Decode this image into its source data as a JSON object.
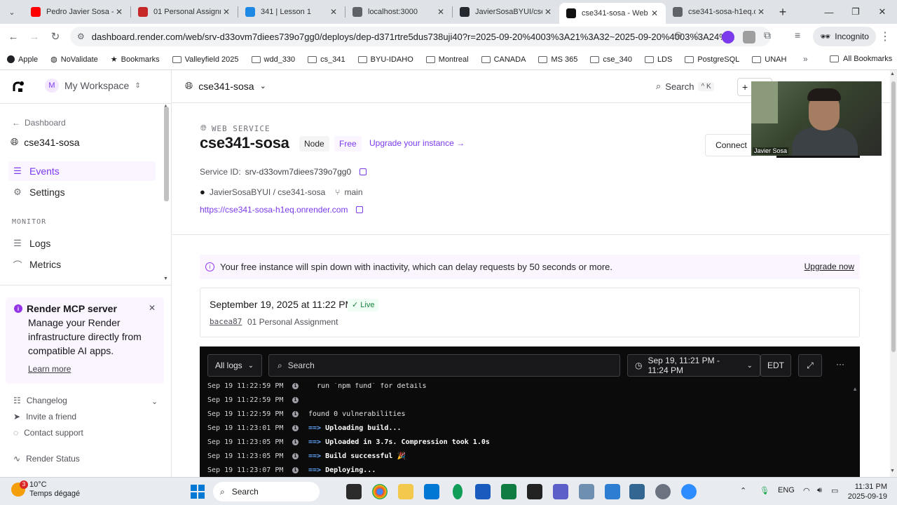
{
  "browser": {
    "tabs": [
      {
        "title": "Pedro Javier Sosa - Y",
        "favicon_color": "#ff0000"
      },
      {
        "title": "01 Personal Assignm",
        "favicon_color": "#c62828"
      },
      {
        "title": "341 | Lesson 1",
        "favicon_color": "#1e88e5"
      },
      {
        "title": "localhost:3000",
        "favicon_color": "#5f6368"
      },
      {
        "title": "JavierSosaBYUI/cse3",
        "favicon_color": "#24292f"
      },
      {
        "title": "cse341-sosa - Web S",
        "favicon_color": "#111111",
        "active": true
      },
      {
        "title": "cse341-sosa-h1eq.or",
        "favicon_color": "#5f6368"
      }
    ],
    "url": "dashboard.render.com/web/srv-d33ovm7diees739o7gg0/deploys/dep-d371rtre5dus738uji40?r=2025-09-20%4003%3A21%3A32~2025-09-20%4003%3A24%...",
    "incognito_label": "Incognito",
    "bookmarks": [
      {
        "label": "Apple",
        "icon": "apple-icon"
      },
      {
        "label": "NoValidate",
        "icon": "globe-icon"
      },
      {
        "label": "Bookmarks",
        "icon": "star-icon"
      },
      {
        "label": "Valleyfield 2025",
        "icon": "folder-icon"
      },
      {
        "label": "wdd_330",
        "icon": "folder-icon"
      },
      {
        "label": "cs_341",
        "icon": "folder-icon"
      },
      {
        "label": "BYU-IDAHO",
        "icon": "folder-icon"
      },
      {
        "label": "Montreal",
        "icon": "folder-icon"
      },
      {
        "label": "CANADA",
        "icon": "folder-icon"
      },
      {
        "label": "MS 365",
        "icon": "folder-icon"
      },
      {
        "label": "cse_340",
        "icon": "folder-icon"
      },
      {
        "label": "LDS",
        "icon": "folder-icon"
      },
      {
        "label": "PostgreSQL",
        "icon": "folder-icon"
      },
      {
        "label": "UNAH",
        "icon": "folder-icon"
      }
    ],
    "all_bookmarks": "All Bookmarks"
  },
  "sidebar": {
    "workspace_initial": "M",
    "workspace": "My Workspace",
    "back_label": "Dashboard",
    "service_name": "cse341-sosa",
    "nav": [
      {
        "label": "Events",
        "icon": "list-icon",
        "active": true
      },
      {
        "label": "Settings",
        "icon": "gear-icon"
      }
    ],
    "monitor_label": "MONITOR",
    "monitor": [
      {
        "label": "Logs",
        "icon": "logs-icon"
      },
      {
        "label": "Metrics",
        "icon": "chart-icon"
      }
    ],
    "mcp": {
      "title": "Render MCP server",
      "body": "Manage your Render infrastructure directly from compatible AI apps.",
      "link": "Learn more"
    },
    "footer": [
      {
        "label": "Changelog",
        "icon": "changelog-icon"
      },
      {
        "label": "Invite a friend",
        "icon": "send-icon"
      },
      {
        "label": "Contact support",
        "icon": "chat-icon"
      },
      {
        "label": "Render Status",
        "icon": "pulse-icon"
      }
    ]
  },
  "topbar": {
    "project": "cse341-sosa",
    "search": "Search",
    "shortcut": "^ K",
    "plus": "+"
  },
  "service": {
    "kind": "WEB SERVICE",
    "name": "cse341-sosa",
    "runtime": "Node",
    "plan": "Free",
    "upgrade": "Upgrade your instance →",
    "connect": "Connect",
    "id_label": "Service ID:",
    "id": "srv-d33ovm7diees739o7gg0",
    "repo": "JavierSosaBYUI / cse341-sosa",
    "branch": "main",
    "url": "https://cse341-sosa-h1eq.onrender.com"
  },
  "banner": {
    "text": "Your free instance will spin down with inactivity, which can delay requests by 50 seconds or more.",
    "action": "Upgrade now"
  },
  "deploy": {
    "date": "September 19, 2025 at 11:22 PM",
    "status": "Live",
    "commit": "bacea87",
    "message": "01 Personal Assignment"
  },
  "logs": {
    "filter": "All logs",
    "search_placeholder": "Search",
    "range": "Sep 19, 11:21 PM - 11:24 PM",
    "timezone": "EDT",
    "lines": [
      {
        "ts": "Sep 19 11:22:59 PM",
        "msg": "  run `npm fund` for details",
        "style": "plain"
      },
      {
        "ts": "Sep 19 11:22:59 PM",
        "msg": "",
        "style": "plain"
      },
      {
        "ts": "Sep 19 11:22:59 PM",
        "msg": "found 0 vulnerabilities",
        "style": "plain"
      },
      {
        "ts": "Sep 19 11:23:01 PM",
        "msg": "Uploading build...",
        "style": "arrow"
      },
      {
        "ts": "Sep 19 11:23:05 PM",
        "msg": "Uploaded in 3.7s. Compression took 1.0s",
        "style": "arrow"
      },
      {
        "ts": "Sep 19 11:23:05 PM",
        "msg": "Build successful 🎉",
        "style": "arrow"
      },
      {
        "ts": "Sep 19 11:23:07 PM",
        "msg": "Deploying...",
        "style": "arrow"
      }
    ],
    "arrow": "==>"
  },
  "webcam": {
    "name": "Javier Sosa"
  },
  "taskbar": {
    "temp": "10°C",
    "weather": "Temps dégagé",
    "badge": "3",
    "search": "Search",
    "lang": "ENG",
    "time": "11:31 PM",
    "date": "2025-09-19"
  }
}
